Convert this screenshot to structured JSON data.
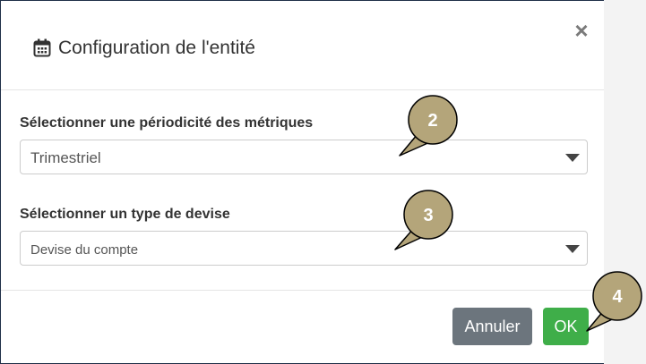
{
  "dialog": {
    "title": "Configuration de l'entité",
    "title_icon": "calendar-icon",
    "close_symbol": "×"
  },
  "fields": [
    {
      "label": "Sélectionner une périodicité des métriques",
      "value": "Trimestriel"
    },
    {
      "label": "Sélectionner un type de devise",
      "value": "Devise du compte"
    }
  ],
  "footer": {
    "cancel_label": "Annuler",
    "ok_label": "OK"
  },
  "callouts": [
    "2",
    "3",
    "4"
  ],
  "colors": {
    "ok_button": "#3fae49",
    "cancel_button": "#6c757d",
    "callout_fill": "#b4a57a",
    "frame_border": "#1f2f47"
  }
}
